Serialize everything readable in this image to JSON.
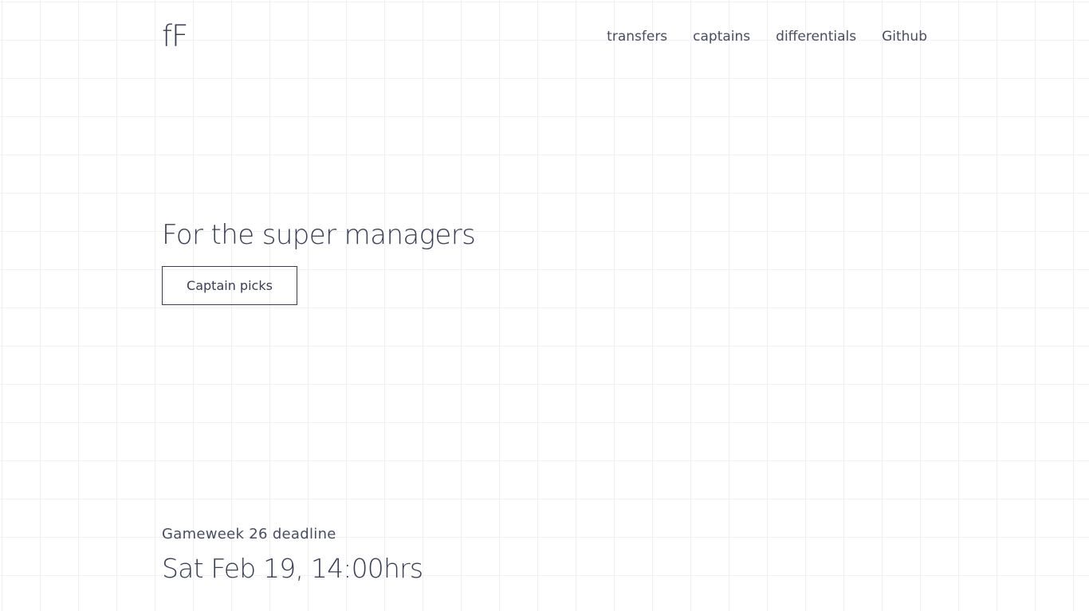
{
  "header": {
    "logo": "fF",
    "nav": [
      {
        "label": "transfers"
      },
      {
        "label": "captains"
      },
      {
        "label": "differentials"
      },
      {
        "label": "Github"
      }
    ]
  },
  "hero": {
    "title": "For the super managers",
    "button_label": "Captain picks"
  },
  "deadline": {
    "label": "Gameweek 26 deadline",
    "value": "Sat Feb 19, 14:00hrs"
  },
  "colors": {
    "text": "#3b3d52",
    "background": "#ffffff",
    "grid": "#f1f1f4"
  }
}
